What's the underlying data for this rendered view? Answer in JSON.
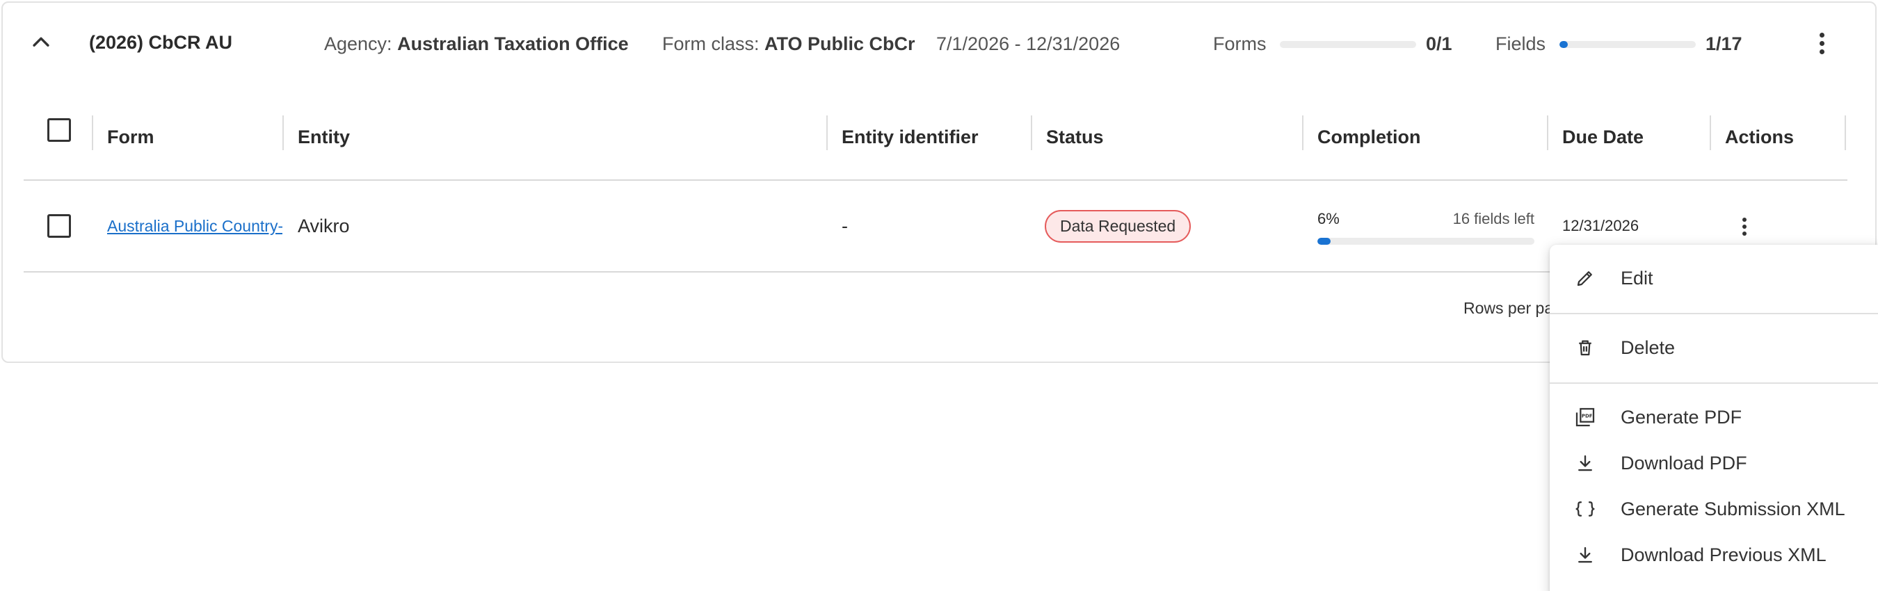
{
  "group": {
    "title": "(2026) CbCR AU",
    "agency_label": "Agency:",
    "agency_value": "Australian Taxation Office",
    "form_class_label": "Form class:",
    "form_class_value": "ATO Public CbCr",
    "date_range": "7/1/2026 - 12/31/2026",
    "forms_label": "Forms",
    "forms_count": "0/1",
    "forms_progress": 0.0,
    "fields_label": "Fields",
    "fields_count": "1/17",
    "fields_progress": 0.06
  },
  "table": {
    "columns": [
      "Form",
      "Entity",
      "Entity identifier",
      "Status",
      "Completion",
      "Due Date",
      "Actions"
    ],
    "rows": [
      {
        "form": "Australia Public Country-by-Country Report",
        "entity": "Avikro",
        "entity_identifier": "-",
        "status": "Data Requested",
        "completion_pct": "6%",
        "completion_value": 6,
        "fields_left": "16 fields left",
        "due_date": "12/31/2026"
      }
    ]
  },
  "pager": {
    "rows_per_page_label": "Rows per page"
  },
  "menu": {
    "items": [
      {
        "label": "Edit",
        "icon": "pencil-icon"
      },
      {
        "label": "Delete",
        "icon": "trash-icon"
      },
      {
        "label": "Generate PDF",
        "icon": "pdf-icon"
      },
      {
        "label": "Download PDF",
        "icon": "download-icon"
      },
      {
        "label": "Generate Submission XML",
        "icon": "braces-icon"
      },
      {
        "label": "Download Previous XML",
        "icon": "download-icon"
      }
    ]
  },
  "colors": {
    "accent": "#1a73d2",
    "link": "#1a6fc9",
    "badge_bg": "#fde8e8",
    "badge_border": "#e55b5b"
  }
}
